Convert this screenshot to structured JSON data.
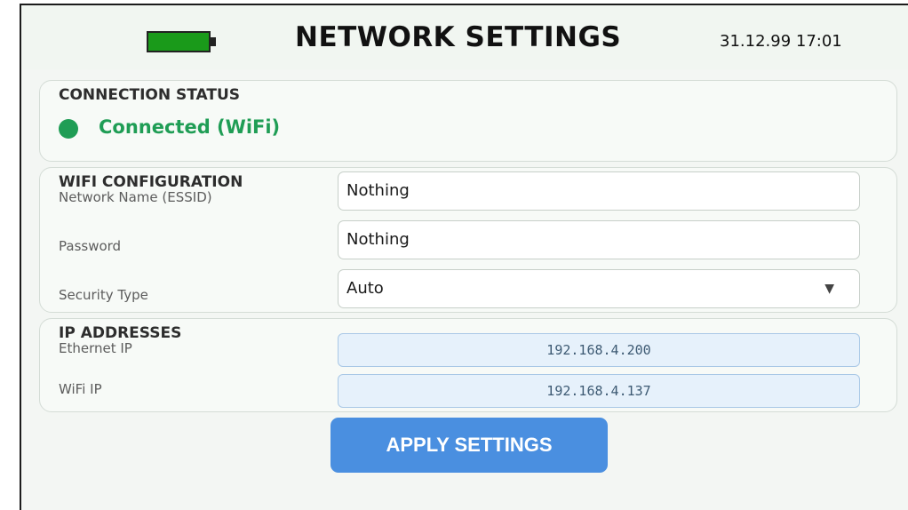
{
  "header": {
    "title": "NETWORK SETTINGS",
    "datetime": "31.12.99 17:01",
    "battery_icon": "battery-icon",
    "battery_color": "#1a9a1a"
  },
  "connection_status": {
    "title": "CONNECTION STATUS",
    "status_text": "Connected (WiFi)",
    "status_color": "#1f9d55"
  },
  "wifi_configuration": {
    "title": "WIFI CONFIGURATION",
    "essid_label": "Network Name (ESSID)",
    "essid_value": "Nothing",
    "password_label": "Password",
    "password_value": "Nothing",
    "security_label": "Security Type",
    "security_value": "Auto",
    "dropdown_icon": "chevron-down-icon"
  },
  "ip_addresses": {
    "title": "IP ADDRESSES",
    "ethernet_label": "Ethernet IP",
    "ethernet_value": "192.168.4.200",
    "wifi_label": "WiFi IP",
    "wifi_value": "192.168.4.137"
  },
  "actions": {
    "apply_label": "APPLY SETTINGS",
    "apply_color": "#4a8fe0"
  }
}
